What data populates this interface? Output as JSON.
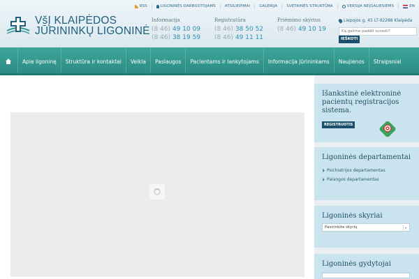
{
  "top_links": [
    {
      "label": "RSS",
      "icon": "rss-icon"
    },
    {
      "label": "LIGONINĖS DARBUOTOJAMS",
      "icon": "user-icon"
    },
    {
      "label": "ATSILIEPIMAI"
    },
    {
      "label": "GALERIJA"
    },
    {
      "label": "SVETAINĖS STRUKTŪRA"
    },
    {
      "label": "VERSIJA NEĮGALIESIEMS",
      "icon": "accessibility-icon"
    },
    {
      "label": "EN",
      "icon": "flag-icon"
    }
  ],
  "logo": {
    "line1": "VšĮ KLAIPĖDOS",
    "line2": "JŪRININKŲ LIGONINĖ"
  },
  "contacts": [
    {
      "label": "Informacija",
      "lines": [
        {
          "code": "(8 46)",
          "number": "49 10 09"
        },
        {
          "code": "(8 46)",
          "number": "38 19 59"
        }
      ]
    },
    {
      "label": "Registratūra",
      "lines": [
        {
          "code": "(8 46)",
          "number": "38 50 52"
        },
        {
          "code": "(8 46)",
          "number": "49 11 11"
        }
      ]
    },
    {
      "label": "Priėmimo skyrius",
      "lines": [
        {
          "code": "(8 46)",
          "number": "49 10 19"
        }
      ]
    }
  ],
  "address": "Liepojos g. 45 LT-92288 Klaipėda",
  "search": {
    "placeholder": "Ką galime padėti surasti?",
    "button": "IEŠKOTI"
  },
  "nav": {
    "items": [
      "Apie ligoninę",
      "Struktūra ir kontaktai",
      "Veikla",
      "Paslaugos",
      "Pacientams ir lankytojams",
      "Informacija jūrininkams",
      "Naujienos",
      "Straipsniai"
    ]
  },
  "sidebar": {
    "registration": {
      "title": "Išankstinė elektroninė pacientų registracijos sistema.",
      "button": "REGISTRUOTIS"
    },
    "departments": {
      "title": "Ligoninės departamentai",
      "items": [
        "Psichiatrijos departamentas",
        "Palangos departamentas"
      ]
    },
    "units": {
      "title": "Ligoninės skyriai",
      "selected": "Pasirinkite skyrių"
    },
    "doctors": {
      "title": "Ligoninės gydytojai"
    }
  },
  "colors": {
    "brand": "#1d5f7d",
    "nav": "#2f9990",
    "accent": "#2f8fb3",
    "sidebar_widget": "#c9e4ee"
  }
}
